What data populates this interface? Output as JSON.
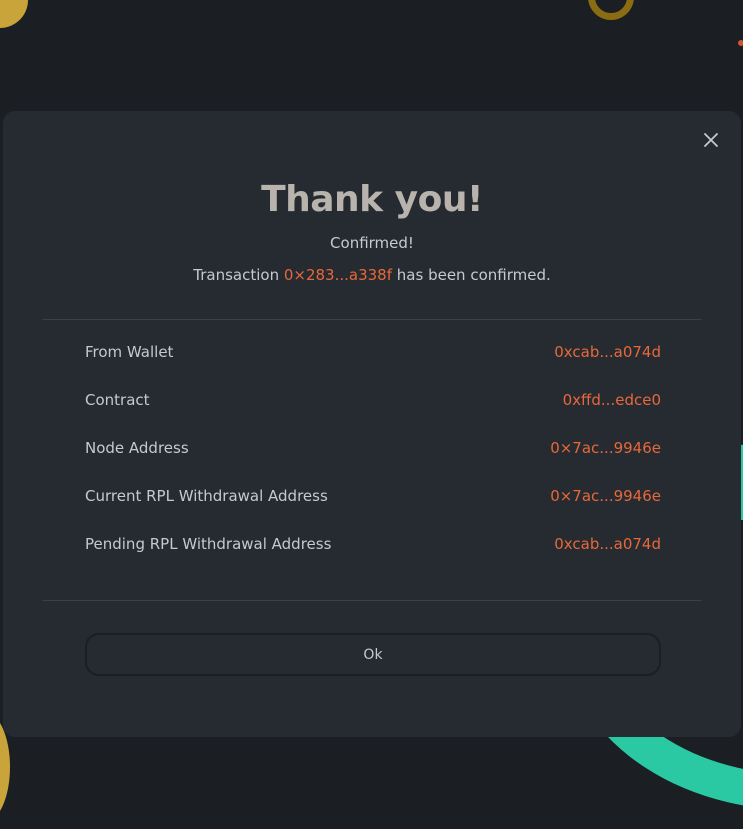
{
  "modal": {
    "title": "Thank you!",
    "subtitle": "Confirmed!",
    "transaction": {
      "prefix": "Transaction ",
      "hash": "0×283...a338f",
      "suffix": " has been confirmed."
    },
    "close_icon": "close-icon",
    "details": [
      {
        "label": "From Wallet",
        "value": "0xcab...a074d"
      },
      {
        "label": "Contract",
        "value": "0xffd...edce0"
      },
      {
        "label": "Node Address",
        "value": "0×7ac...9946e"
      },
      {
        "label": "Current RPL Withdrawal Address",
        "value": "0×7ac...9946e"
      },
      {
        "label": "Pending RPL Withdrawal Address",
        "value": "0xcab...a074d"
      }
    ],
    "ok_label": "Ok"
  },
  "colors": {
    "background": "#1b1e22",
    "modal_background": "#262a31",
    "accent": "#e8683a",
    "text": "#c7c9cc",
    "title": "#b8b4ad",
    "teal_decoration": "#2bc9a3",
    "gold_decoration": "#c9a43a"
  }
}
